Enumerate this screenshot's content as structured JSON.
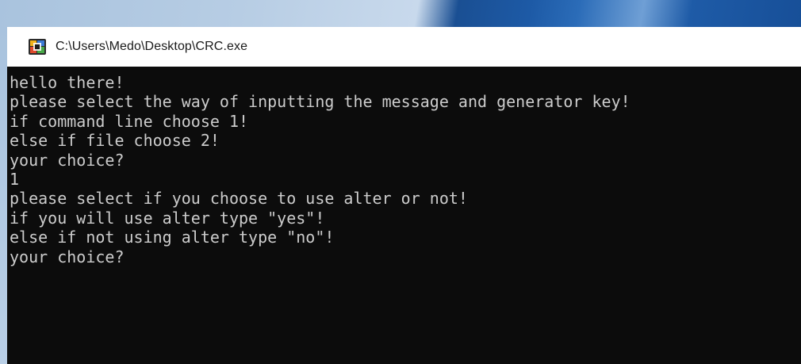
{
  "window": {
    "title": "C:\\Users\\Medo\\Desktop\\CRC.exe",
    "icon": "console-app-icon"
  },
  "console": {
    "lines": [
      "hello there!",
      "please select the way of inputting the message and generator key!",
      "if command line choose 1!",
      "else if file choose 2!",
      "your choice?",
      "1",
      "please select if you choose to use alter or not!",
      "if you will use alter type \"yes\"!",
      "else if not using alter type \"no\"!",
      "your choice?"
    ]
  },
  "colors": {
    "console_background": "#0c0c0c",
    "console_text": "#cccccc",
    "title_bar": "#ffffff"
  }
}
